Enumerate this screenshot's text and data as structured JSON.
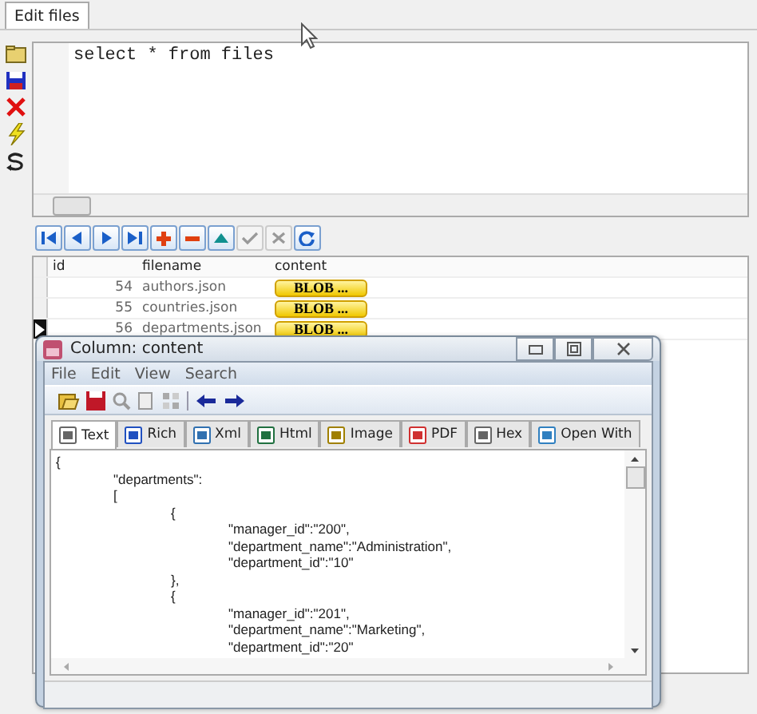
{
  "tab": {
    "label": "Edit files",
    "selected": true
  },
  "editor": {
    "text": "select * from files"
  },
  "nav_toolbar": [
    {
      "kind": "first",
      "disabled": false
    },
    {
      "kind": "prior",
      "disabled": false
    },
    {
      "kind": "next",
      "disabled": false
    },
    {
      "kind": "last",
      "disabled": false
    },
    {
      "kind": "insert",
      "disabled": false
    },
    {
      "kind": "delete",
      "disabled": false
    },
    {
      "kind": "edit",
      "disabled": false
    },
    {
      "kind": "post",
      "disabled": true
    },
    {
      "kind": "cancel",
      "disabled": true
    },
    {
      "kind": "refresh",
      "disabled": false
    }
  ],
  "grid": {
    "columns": [
      "id",
      "filename",
      "content"
    ],
    "rows": [
      {
        "id": "54",
        "filename": "authors.json",
        "content": "BLOB ...",
        "current": false
      },
      {
        "id": "55",
        "filename": "countries.json",
        "content": "BLOB ...",
        "current": false
      },
      {
        "id": "56",
        "filename": "departments.json",
        "content": "BLOB ...",
        "current": true
      }
    ]
  },
  "dialog": {
    "title": "Column: content",
    "menu": [
      "File",
      "Edit",
      "View",
      "Search"
    ],
    "tabs": [
      {
        "label": "Text",
        "selected": true
      },
      {
        "label": "Rich",
        "selected": false
      },
      {
        "label": "Xml",
        "selected": false
      },
      {
        "label": "Html",
        "selected": false
      },
      {
        "label": "Image",
        "selected": false
      },
      {
        "label": "PDF",
        "selected": false
      },
      {
        "label": "Hex",
        "selected": false
      },
      {
        "label": "Open With",
        "selected": false
      }
    ],
    "content": "{\n\t\"departments\":\n\t[\n\t\t{\n\t\t\t\"manager_id\":\"200\",\n\t\t\t\"department_name\":\"Administration\",\n\t\t\t\"department_id\":\"10\"\n\t\t},\n\t\t{\n\t\t\t\"manager_id\":\"201\",\n\t\t\t\"department_name\":\"Marketing\",\n\t\t\t\"department_id\":\"20\""
  }
}
